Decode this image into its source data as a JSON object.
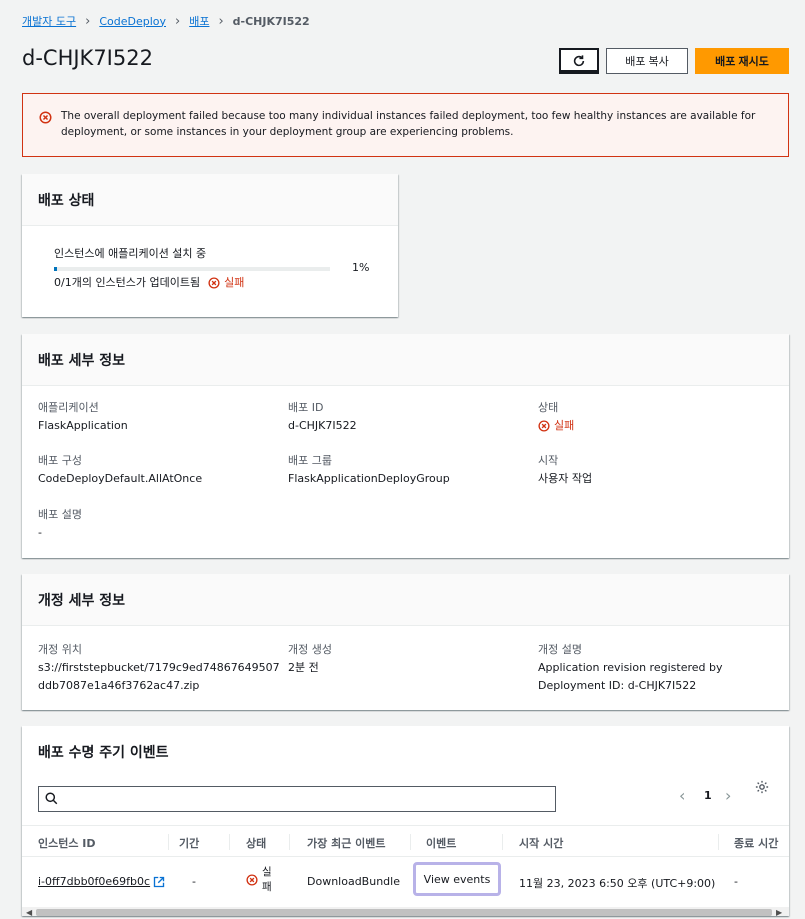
{
  "breadcrumb": {
    "items": [
      "개발자 도구",
      "CodeDeploy",
      "배포"
    ],
    "current": "d-CHJK7I522"
  },
  "page": {
    "title": "d-CHJK7I522",
    "copy_label": "배포 복사",
    "retry_label": "배포 재시도"
  },
  "alert": {
    "message": "The overall deployment failed because too many individual instances failed deployment, too few healthy instances are available for deployment, or some instances in your deployment group are experiencing problems."
  },
  "status_panel": {
    "title": "배포 상태",
    "step_label": "인스턴스에 애플리케이션 설치 중",
    "progress_percent": 1,
    "progress_text": "1%",
    "updated_text": "0/1개의 인스턴스가 업데이트됨",
    "status": "실패"
  },
  "details": {
    "title": "배포 세부 정보",
    "application_label": "애플리케이션",
    "application_value": "FlaskApplication",
    "deploy_id_label": "배포 ID",
    "deploy_id_value": "d-CHJK7I522",
    "status_label": "상태",
    "status_value": "실패",
    "config_label": "배포 구성",
    "config_value": "CodeDeployDefault.AllAtOnce",
    "group_label": "배포 그룹",
    "group_value": "FlaskApplicationDeployGroup",
    "start_label": "시작",
    "start_value": "사용자 작업",
    "desc_label": "배포 설명",
    "desc_value": "-"
  },
  "revision": {
    "title": "개정 세부 정보",
    "location_label": "개정 위치",
    "location_line1": "s3://firststepbucket/7179c9ed74867649507",
    "location_line2": "ddb7087e1a46f3762ac47.zip",
    "created_label": "개정 생성",
    "created_value": "2분 전",
    "desc_label": "개정 설명",
    "desc_line1": "Application revision registered by",
    "desc_line2": "Deployment ID: d-CHJK7I522"
  },
  "events": {
    "title": "배포 수명 주기 이벤트",
    "search_placeholder": "",
    "page_number": "1",
    "columns": [
      "인스턴스 ID",
      "기간",
      "상태",
      "가장 최근 이벤트",
      "이벤트",
      "시작 시간",
      "종료 시간"
    ],
    "rows": [
      {
        "instance_id": "i-0ff7dbb0f0e69fb0c",
        "duration": "-",
        "status_line1": "실",
        "status_line2": "패",
        "latest_event": "DownloadBundle",
        "events_link": "View events",
        "start_time": "11월 23, 2023 6:50 오후 (UTC+9:00)",
        "end_time": "-"
      }
    ]
  },
  "colors": {
    "primary_orange": "#ff9900",
    "error_red": "#d13212",
    "link_blue": "#0972d3"
  }
}
